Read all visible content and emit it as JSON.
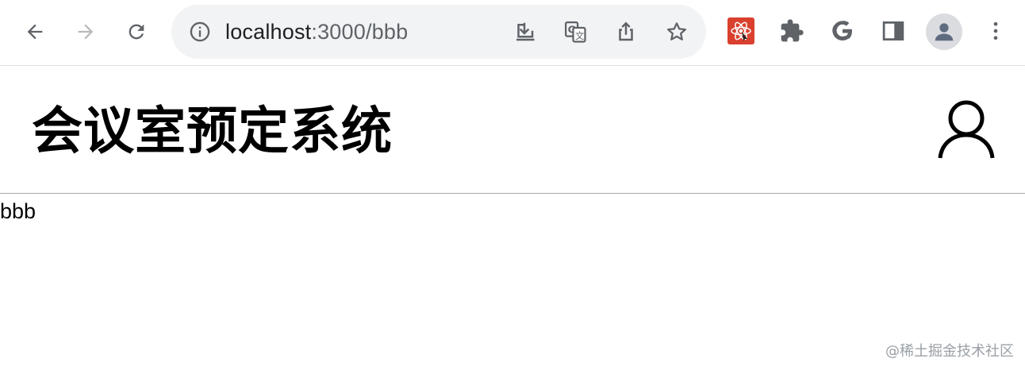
{
  "browser": {
    "url_host": "localhost",
    "url_rest": ":3000/bbb",
    "icons": {
      "back": "arrow-left-icon",
      "forward": "arrow-right-icon",
      "reload": "reload-icon",
      "info": "info-icon",
      "install": "install-icon",
      "translate": "translate-icon",
      "share": "share-icon",
      "bookmark": "star-icon",
      "react_devtools": "react-devtools-icon",
      "extensions": "puzzle-icon",
      "google": "google-icon",
      "side_panel": "side-panel-icon",
      "profile": "profile-avatar-icon",
      "menu": "kebab-menu-icon"
    }
  },
  "app": {
    "title": "会议室预定系统",
    "user_icon": "user-icon"
  },
  "content": {
    "text": "bbb"
  },
  "watermark": "@稀土掘金技术社区",
  "colors": {
    "omnibox_bg": "#f1f3f4",
    "react_ext": "#d9412e",
    "divider": "#aaaaaa"
  }
}
